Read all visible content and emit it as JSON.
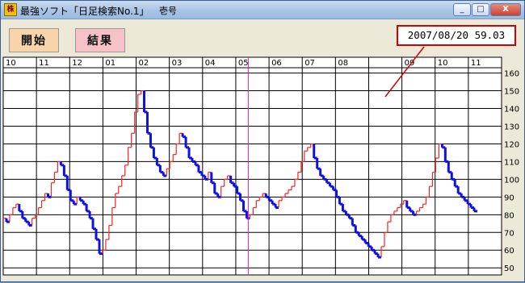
{
  "window": {
    "title": "最強ソフト「日足検索No.1」",
    "subtitle": "壱号",
    "icon": "app-icon",
    "min_label": "_",
    "max_label": "□",
    "close_label": "X"
  },
  "toolbar": {
    "start_label": "開始",
    "result_label": "結果"
  },
  "readout": {
    "text": "2007/08/20 59.03"
  },
  "colors": {
    "up": "#ff2020",
    "down": "#1010e0",
    "cursor": "#e020e0",
    "grid": "#000000",
    "callout": "#d40000"
  },
  "chart_data": {
    "type": "line",
    "x_tick_labels": [
      "10",
      "11",
      "12",
      "01",
      "02",
      "03",
      "04",
      "05",
      "06",
      "07",
      "08",
      "",
      "09",
      "10",
      "11"
    ],
    "y_ticks": [
      50,
      60,
      70,
      80,
      90,
      100,
      110,
      120,
      130,
      140,
      150,
      160
    ],
    "ylim": [
      46,
      163
    ],
    "grid": true,
    "cursor_index": 76,
    "series": [
      {
        "values": [
          78,
          76,
          80,
          84,
          86,
          82,
          78,
          76,
          74,
          78,
          80,
          84,
          88,
          92,
          90,
          98,
          104,
          110,
          108,
          102,
          94,
          88,
          86,
          90,
          88,
          86,
          82,
          78,
          72,
          66,
          58,
          60,
          66,
          74,
          84,
          92,
          96,
          102,
          108,
          118,
          126,
          138,
          148,
          150,
          138,
          126,
          118,
          112,
          108,
          104,
          102,
          106,
          110,
          114,
          120,
          126,
          124,
          118,
          112,
          110,
          108,
          104,
          102,
          100,
          104,
          98,
          92,
          90,
          96,
          100,
          102,
          98,
          96,
          92,
          88,
          82,
          78,
          80,
          84,
          88,
          90,
          92,
          90,
          88,
          86,
          84,
          88,
          90,
          92,
          94,
          96,
          100,
          104,
          110,
          116,
          118,
          120,
          112,
          106,
          102,
          100,
          98,
          96,
          94,
          90,
          86,
          82,
          80,
          78,
          74,
          70,
          68,
          66,
          64,
          62,
          60,
          58,
          56,
          62,
          70,
          76,
          80,
          82,
          84,
          86,
          88,
          84,
          82,
          80,
          82,
          84,
          86,
          90,
          96,
          104,
          112,
          120,
          118,
          110,
          104,
          100,
          96,
          92,
          90,
          88,
          86,
          84,
          82
        ]
      }
    ]
  }
}
